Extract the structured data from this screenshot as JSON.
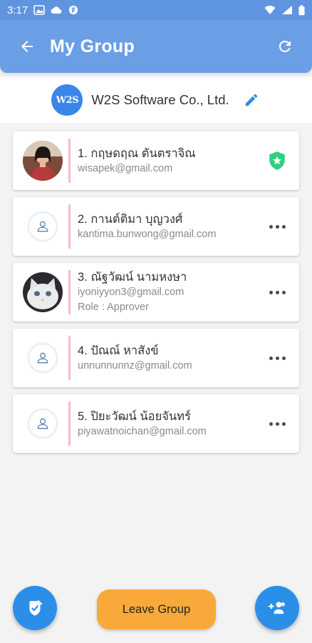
{
  "status_bar": {
    "time": "3:17",
    "icons_left": [
      "gallery-icon",
      "cloud-icon",
      "app-f-icon"
    ],
    "icons_right": [
      "wifi-icon",
      "signal-icon",
      "battery-icon"
    ]
  },
  "app_bar": {
    "title": "My Group",
    "back_icon": "arrow-left-icon",
    "refresh_icon": "refresh-icon"
  },
  "organization": {
    "logo_text": "W2S",
    "name": "W2S Software Co., Ltd.",
    "edit_icon": "pencil-icon"
  },
  "members": [
    {
      "name": "1. กฤษดฤณ ตันตราจิณ",
      "email": "wisapek@gmail.com",
      "role": "",
      "avatar": "photo-person",
      "action": "admin-shield-icon"
    },
    {
      "name": "2. กานต์ติมา บุญวงศ์",
      "email": "kantima.bunwong@gmail.com",
      "role": "",
      "avatar": "placeholder-person-icon",
      "action": "more-options-icon"
    },
    {
      "name": "3. ณัฐวัฒน์ นามหงษา",
      "email": "iyoniyyon3@gmail.com",
      "role": "Role : Approver",
      "avatar": "photo-cat",
      "action": "more-options-icon"
    },
    {
      "name": "4. ปัณณ์ หาสังข์",
      "email": "unnunnunnz@gmail.com",
      "role": "",
      "avatar": "placeholder-person-icon",
      "action": "more-options-icon"
    },
    {
      "name": "5. ปิยะวัฒน์ น้อยจันทร์",
      "email": "piyawatnoichan@gmail.com",
      "role": "",
      "avatar": "placeholder-person-icon",
      "action": "more-options-icon"
    }
  ],
  "bottom_bar": {
    "leave_label": "Leave Group",
    "left_fab_icon": "approve-pen-icon",
    "right_fab_icon": "add-member-icon"
  },
  "colors": {
    "app_bar": "#6a9fe6",
    "status_bar": "#5f95e0",
    "fab": "#2b8fe8",
    "leave_button": "#f9a93a",
    "card_divider": "#f5bcc7",
    "admin_shield": "#2fd07e"
  }
}
